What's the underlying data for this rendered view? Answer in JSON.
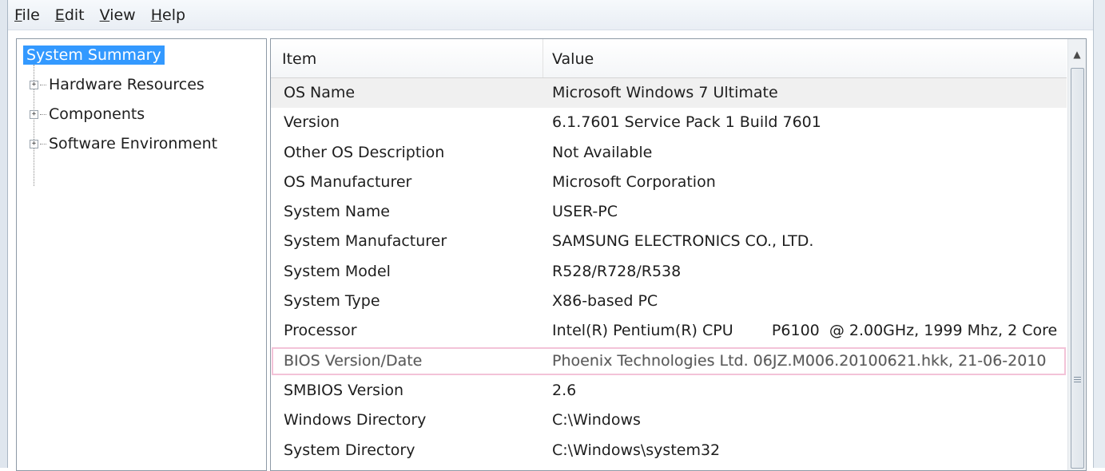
{
  "menu": [
    {
      "accel": "F",
      "rest": "ile"
    },
    {
      "accel": "E",
      "rest": "dit"
    },
    {
      "accel": "V",
      "rest": "iew"
    },
    {
      "accel": "H",
      "rest": "elp"
    }
  ],
  "tree": {
    "root": "System Summary",
    "children": [
      "Hardware Resources",
      "Components",
      "Software Environment"
    ],
    "expander_glyph": "+"
  },
  "list": {
    "header": {
      "item": "Item",
      "value": "Value"
    },
    "rows": [
      {
        "item": "OS Name",
        "value": "Microsoft Windows 7 Ultimate"
      },
      {
        "item": "Version",
        "value": "6.1.7601 Service Pack 1 Build 7601"
      },
      {
        "item": "Other OS Description",
        "value": "Not Available"
      },
      {
        "item": "OS Manufacturer",
        "value": "Microsoft Corporation"
      },
      {
        "item": "System Name",
        "value": "USER-PC"
      },
      {
        "item": "System Manufacturer",
        "value": "SAMSUNG ELECTRONICS CO., LTD."
      },
      {
        "item": "System Model",
        "value": "R528/R728/R538"
      },
      {
        "item": "System Type",
        "value": "X86-based PC"
      },
      {
        "item": "Processor",
        "value": "Intel(R) Pentium(R) CPU        P6100  @ 2.00GHz, 1999 Mhz, 2 Core"
      },
      {
        "item": "BIOS Version/Date",
        "value": "Phoenix Technologies Ltd. 06JZ.M006.20100621.hkk, 21-06-2010"
      },
      {
        "item": "SMBIOS Version",
        "value": "2.6"
      },
      {
        "item": "Windows Directory",
        "value": "C:\\Windows"
      },
      {
        "item": "System Directory",
        "value": "C:\\Windows\\system32"
      }
    ],
    "selected_row": "BIOS Version/Date"
  },
  "scrollbar": {
    "up_arrow": "▲"
  },
  "colors": {
    "selection": "#3399ff",
    "selected_row_outline": "#f3c3d8"
  }
}
